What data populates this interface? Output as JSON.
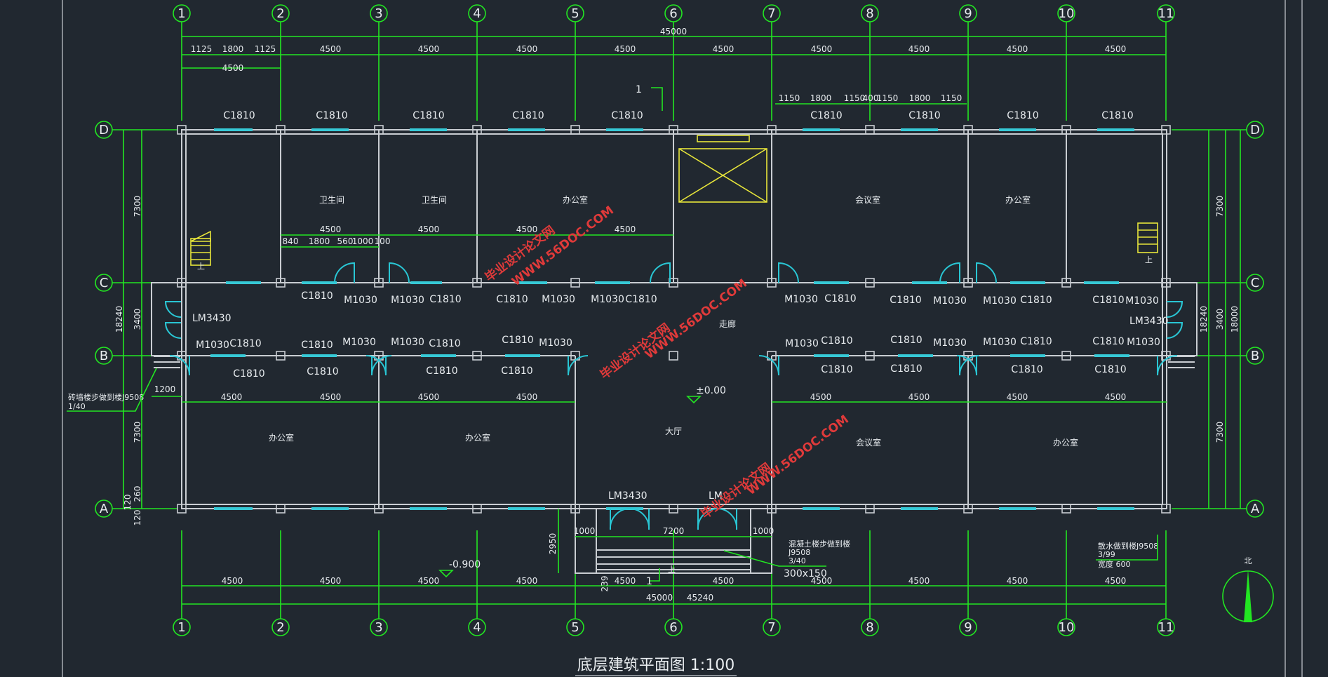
{
  "title": "底层建筑平面图 1:100",
  "axes_numbers": [
    "1",
    "2",
    "3",
    "4",
    "5",
    "6",
    "7",
    "8",
    "9",
    "10",
    "11"
  ],
  "axes_letters": [
    "D",
    "C",
    "B",
    "A"
  ],
  "dims": {
    "overall_top": "45000",
    "top_row": [
      "1125",
      "1800",
      "1125",
      "4500",
      "4500",
      "4500",
      "4500",
      "4500",
      "4500",
      "4500",
      "4500",
      "4500"
    ],
    "top_sub": "4500",
    "right_window_row": [
      "1150",
      "1800",
      "1150",
      "400",
      "1150",
      "1800",
      "1150"
    ],
    "inner_toilet": [
      "4500",
      "4500",
      "4500",
      "4500"
    ],
    "inner_toilet_sub": [
      "840",
      "1800",
      "560",
      "1000",
      "100"
    ],
    "mid_row": [
      "4500",
      "4500",
      "4500",
      "4500",
      "4500",
      "4500",
      "4500",
      "4500"
    ],
    "bottom_row": [
      "4500",
      "4500",
      "4500",
      "4500",
      "4500",
      "4500",
      "4500",
      "4500",
      "4500",
      "4500"
    ],
    "overall_bottom": [
      "45000",
      "45240"
    ],
    "left_vertical": [
      "7300",
      "3400",
      "7300",
      "18240",
      "120",
      "260",
      "120"
    ],
    "right_vertical": [
      "7300",
      "3400",
      "7300",
      "18240",
      "18000"
    ],
    "entrance": [
      "1000",
      "7200",
      "1000",
      "2950",
      "239",
      "1200"
    ]
  },
  "labels": {
    "windows_top": [
      "C1810",
      "C1810",
      "C1810",
      "C1810",
      "C1810",
      "C1810",
      "C1810",
      "C1810",
      "C1810"
    ],
    "window": "C1810",
    "door": "M1030",
    "lm": "LM3430",
    "lm_partial": "LM",
    "section": "1",
    "level_0": "±0.00",
    "level_out": "-0.900",
    "size_300": "300x150"
  },
  "rooms": {
    "toilet_1": "卫生间",
    "toilet_2": "卫生间",
    "office_n1": "办公室",
    "meeting_n": "会议室",
    "office_n2": "办公室",
    "corridor": "走廊",
    "hall": "大厅",
    "office_s1": "办公室",
    "office_s2": "办公室",
    "meeting_s": "会议室",
    "office_s3": "办公室"
  },
  "notes": {
    "left_note": "砖墙楼步做到楼J9508",
    "left_note_sub": "1/40",
    "entrance_note": "混凝土楼步做到楼",
    "entrance_note_sub1": "J9508",
    "entrance_note_sub2": "3/40",
    "right_note": "散水做到楼J9508",
    "right_note_sub": "3/99",
    "right_note_width": "宽度 600",
    "north": "北",
    "up": "上"
  },
  "watermarks": {
    "site": "毕业设计论文网",
    "url": "WWW.56DOC.COM"
  },
  "colors": {
    "background": "#212830",
    "dimension_green": "#22e622",
    "wall": "#c9cdd2",
    "window_cyan": "#36c9d6",
    "stair_yellow": "#e8e63a",
    "watermark_red": "#e03a3a"
  }
}
